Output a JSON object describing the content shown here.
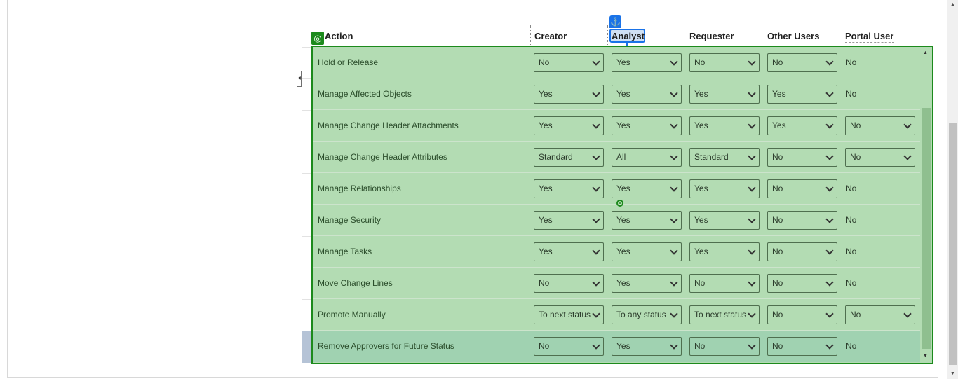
{
  "table": {
    "headers": {
      "action": "Action",
      "creator": "Creator",
      "analyst": "Analyst",
      "requester": "Requester",
      "other_users": "Other Users",
      "portal_user": "Portal User"
    },
    "rows": [
      {
        "label": "Hold or Release",
        "creator": "No",
        "analyst": "Yes",
        "requester": "No",
        "other_users": "No",
        "portal_user": "No",
        "portal_is_select": false
      },
      {
        "label": "Manage Affected Objects",
        "creator": "Yes",
        "analyst": "Yes",
        "requester": "Yes",
        "other_users": "Yes",
        "portal_user": "No",
        "portal_is_select": false
      },
      {
        "label": "Manage Change Header Attachments",
        "creator": "Yes",
        "analyst": "Yes",
        "requester": "Yes",
        "other_users": "Yes",
        "portal_user": "No",
        "portal_is_select": true
      },
      {
        "label": "Manage Change Header Attributes",
        "creator": "Standard",
        "analyst": "All",
        "requester": "Standard",
        "other_users": "No",
        "portal_user": "No",
        "portal_is_select": true
      },
      {
        "label": "Manage Relationships",
        "creator": "Yes",
        "analyst": "Yes",
        "requester": "Yes",
        "other_users": "No",
        "portal_user": "No",
        "portal_is_select": false
      },
      {
        "label": "Manage Security",
        "creator": "Yes",
        "analyst": "Yes",
        "requester": "Yes",
        "other_users": "No",
        "portal_user": "No",
        "portal_is_select": false
      },
      {
        "label": "Manage Tasks",
        "creator": "Yes",
        "analyst": "Yes",
        "requester": "Yes",
        "other_users": "No",
        "portal_user": "No",
        "portal_is_select": false
      },
      {
        "label": "Move Change Lines",
        "creator": "No",
        "analyst": "Yes",
        "requester": "No",
        "other_users": "No",
        "portal_user": "No",
        "portal_is_select": false
      },
      {
        "label": "Promote Manually",
        "creator": "To next status",
        "analyst": "To any status",
        "requester": "To next status",
        "other_users": "No",
        "portal_user": "No",
        "portal_is_select": true
      },
      {
        "label": "Remove Approvers for Future Status",
        "creator": "No",
        "analyst": "Yes",
        "requester": "No",
        "other_users": "No",
        "portal_user": "No",
        "portal_is_select": false
      }
    ]
  },
  "colors": {
    "overlay_fill": "#b3dcb3",
    "overlay_border": "#1c8a1c",
    "highlight_blue": "#1a73e8",
    "selected_row": "#a0d2b1"
  },
  "icons": {
    "anchor": "anchor-icon",
    "target": "target-icon",
    "crosshair": "crosshair-icon"
  }
}
